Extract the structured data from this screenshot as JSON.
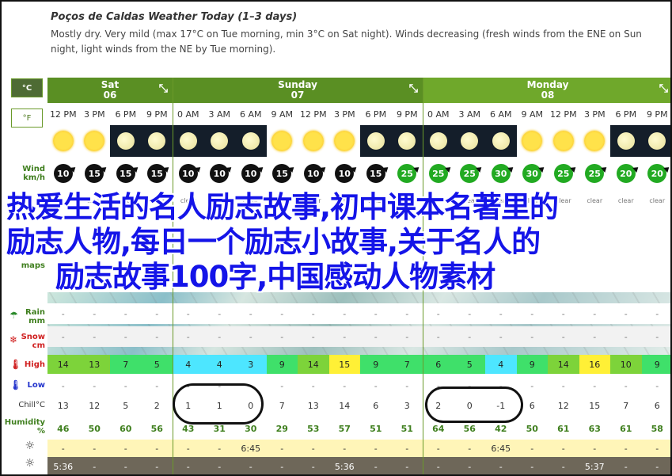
{
  "header": {
    "title": "Poços de Caldas Weather Today (1–3 days)",
    "summary": "Mostly dry. Very mild (max 17°C on Tue morning, min 3°C on Sat night). Winds decreasing (fresh winds from the ENE on Sun night, light winds from the NE by Tue morning)."
  },
  "units": {
    "celsius": "°C",
    "fahrenheit": "°F"
  },
  "row_labels": {
    "wind": "Wind",
    "wind_unit": "km/h",
    "maps": "maps",
    "rain": "Rain",
    "rain_unit": "mm",
    "snow": "Snow",
    "snow_unit": "cm",
    "high": "High",
    "low": "Low",
    "chill": "Chill°C",
    "humidity": "Humidity",
    "humidity_unit": "%"
  },
  "days": [
    {
      "name": "Sat",
      "date": "06",
      "color": "#5a8f23"
    },
    {
      "name": "Sunday",
      "date": "07",
      "color": "#5a8f23"
    },
    {
      "name": "Monday",
      "date": "08",
      "color": "#6fa82b"
    }
  ],
  "times": [
    "12 PM",
    "3 PM",
    "6 PM",
    "9 PM",
    "0 AM",
    "3 AM",
    "6 AM",
    "9 AM",
    "12 PM",
    "3 PM",
    "6 PM",
    "9 PM",
    "0 AM",
    "3 AM",
    "6 AM",
    "9 AM",
    "12 PM",
    "3 PM",
    "6 PM",
    "9 PM"
  ],
  "sky_icons": [
    "sun",
    "sun",
    "moon",
    "moon",
    "moon",
    "moon",
    "moon",
    "sun",
    "sun",
    "sun",
    "moon",
    "moon",
    "moon",
    "moon",
    "moon",
    "sun",
    "sun",
    "sun",
    "moon",
    "moon"
  ],
  "wind": [
    "10",
    "15",
    "15",
    "15",
    "10",
    "10",
    "10",
    "15",
    "10",
    "10",
    "15",
    "25",
    "25",
    "25",
    "30",
    "30",
    "25",
    "25",
    "20",
    "20"
  ],
  "sky_text": [
    "clear",
    "clear",
    "clear",
    "clear",
    "clear",
    "clear",
    "clear",
    "clear",
    "clear",
    "clear",
    "clear",
    "clear",
    "clear",
    "clear",
    "clear",
    "clear",
    "clear",
    "clear",
    "clear",
    "clear"
  ],
  "rain": [
    "-",
    "-",
    "-",
    "-",
    "-",
    "-",
    "-",
    "-",
    "-",
    "-",
    "-",
    "-",
    "-",
    "-",
    "-",
    "-",
    "-",
    "-",
    "-",
    "-"
  ],
  "snow": [
    "-",
    "-",
    "-",
    "-",
    "-",
    "-",
    "-",
    "-",
    "-",
    "-",
    "-",
    "-",
    "-",
    "-",
    "-",
    "-",
    "-",
    "-",
    "-",
    "-"
  ],
  "high": [
    "14",
    "13",
    "7",
    "5",
    "4",
    "4",
    "3",
    "9",
    "14",
    "15",
    "9",
    "7",
    "6",
    "5",
    "4",
    "9",
    "14",
    "16",
    "10",
    "9"
  ],
  "high_colors": [
    "#7dd33a",
    "#7dd33a",
    "#3fe06a",
    "#3fe06a",
    "#4de6ff",
    "#4de6ff",
    "#4de6ff",
    "#3fe06a",
    "#7dd33a",
    "#fff036",
    "#3fe06a",
    "#3fe06a",
    "#3fe06a",
    "#3fe06a",
    "#4de6ff",
    "#3fe06a",
    "#7dd33a",
    "#fff036",
    "#7dd33a",
    "#3fe06a"
  ],
  "low": [
    "-",
    "-",
    "-",
    "-",
    "-",
    "-",
    "-",
    "-",
    "-",
    "-",
    "-",
    "-",
    "-",
    "-",
    "-",
    "-",
    "-",
    "-",
    "-",
    "-"
  ],
  "chill": [
    "13",
    "12",
    "5",
    "2",
    "1",
    "1",
    "0",
    "7",
    "13",
    "14",
    "6",
    "3",
    "2",
    "0",
    "-1",
    "6",
    "12",
    "15",
    "7",
    "6"
  ],
  "humidity": [
    "46",
    "50",
    "60",
    "56",
    "43",
    "31",
    "30",
    "29",
    "53",
    "57",
    "51",
    "51",
    "64",
    "56",
    "42",
    "50",
    "61",
    "63",
    "61",
    "58"
  ],
  "sunrise": [
    "-",
    "-",
    "-",
    "-",
    "-",
    "-",
    "6:45",
    "-",
    "-",
    "-",
    "-",
    "-",
    "-",
    "-",
    "6:45",
    "-",
    "-",
    "-",
    "-",
    "-"
  ],
  "sunset": [
    "5:36",
    "-",
    "-",
    "-",
    "-",
    "-",
    "-",
    "-",
    "-",
    "5:36",
    "-",
    "-",
    "-",
    "-",
    "-",
    "-",
    "-",
    "5:37",
    "-",
    "-"
  ],
  "overlay": {
    "line1": "热爱生活的名人励志故事,初中课本名著里的",
    "line2": "励志人物,每日一个励志小故事,关于名人的",
    "line3": "励志故事100字,中国感动人物素材"
  }
}
